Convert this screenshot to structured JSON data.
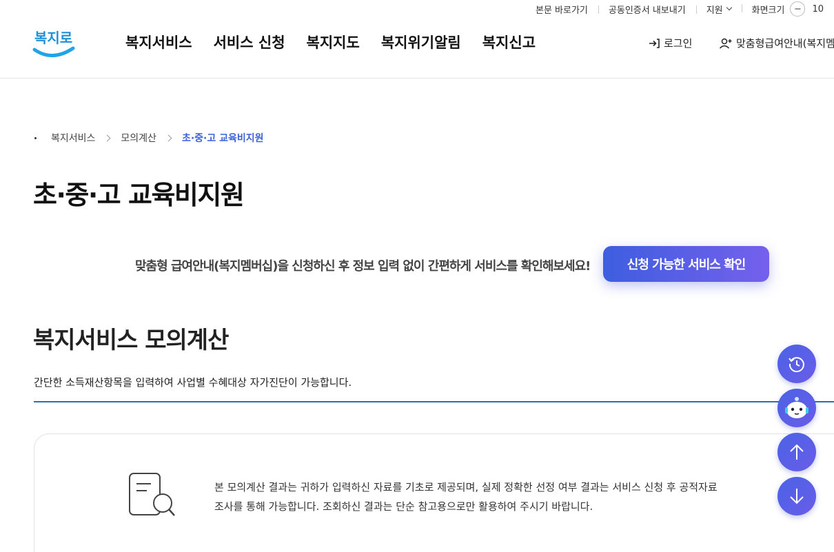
{
  "utility_bar": {
    "skip_link": "본문 바로가기",
    "cert_export": "공동인증서 내보내기",
    "support_label": "지원",
    "screen_size_label": "화면크기",
    "zoom_minus": "−",
    "zoom_value": "10"
  },
  "header": {
    "logo_text": "복지로",
    "nav": [
      "복지서비스",
      "서비스 신청",
      "복지지도",
      "복지위기알림",
      "복지신고"
    ],
    "login_label": "로그인",
    "member_label": "맞춤형급여안내(복지멤"
  },
  "breadcrumb": [
    "복지서비스",
    "모의계산",
    "초·중·고 교육비지원"
  ],
  "page_title": "초·중·고 교육비지원",
  "promo": {
    "text": "맞춤형 급여안내(복지멤버십)을 신청하신 후 정보 입력 없이 간편하게 서비스를 확인해보세요!",
    "button_label": "신청 가능한 서비스 확인"
  },
  "section": {
    "title": "복지서비스 모의계산",
    "description": "간단한 소득재산항목을 입력하여 사업별 수혜대상 자가진단이 가능합니다."
  },
  "notice": {
    "line1": "본 모의계산 결과는 귀하가 입력하신 자료를 기초로 제공되며, 실제 정확한 선정 여부 결과는 서비스 신청 후 공적자료",
    "line2": "조사를 통해 가능합니다. 조회하신 결과는 단순 참고용으로만 활용하여 주시기 바랍니다."
  },
  "floating_buttons": [
    "history-icon",
    "chatbot-icon",
    "arrow-up-icon",
    "arrow-down-icon"
  ],
  "colors": {
    "accent": "#3c61d8",
    "button_gradient_start": "#3e5ee0",
    "button_gradient_end": "#7560ec",
    "section_line": "#2a6fb0"
  }
}
